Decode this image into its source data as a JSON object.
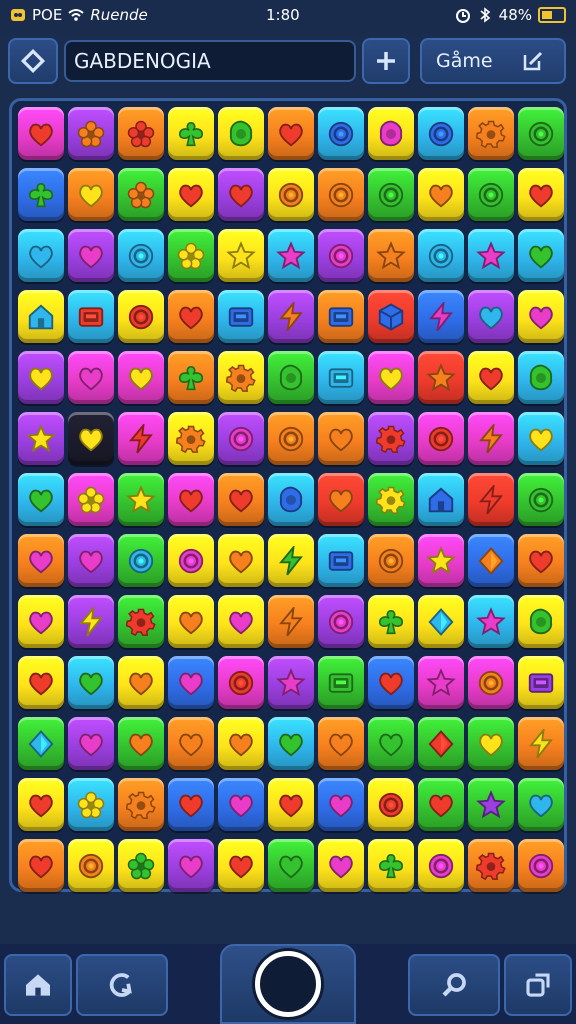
{
  "status_bar": {
    "left_text": "POE",
    "carrier": "Ruende",
    "time": "1:80",
    "battery_percent": "48%"
  },
  "toolbar": {
    "search_text": "GABDENOGIA",
    "game_label": "Gåme"
  },
  "colors": {
    "red": "#ef3b2c",
    "orange": "#f7801e",
    "yellow": "#ffe31a",
    "green": "#35c22f",
    "cyan": "#2fb6ec",
    "blue": "#2f6de8",
    "purple": "#9b3fe0",
    "magenta": "#e83cc9",
    "dark": "#1b1b2b"
  },
  "board": {
    "rows": 13,
    "cols": 11,
    "tiles": [
      [
        [
          "magenta",
          "heart",
          "red"
        ],
        [
          "purple",
          "flower",
          "orange"
        ],
        [
          "orange",
          "flower",
          "red"
        ],
        [
          "yellow",
          "clover",
          "green"
        ],
        [
          "yellow",
          "blob",
          "green"
        ],
        [
          "orange",
          "heart",
          "red"
        ],
        [
          "cyan",
          "ring",
          "blue"
        ],
        [
          "yellow",
          "blob",
          "magenta"
        ],
        [
          "cyan",
          "ring",
          "blue"
        ],
        [
          "orange",
          "gear",
          "orange"
        ],
        [
          "green",
          "ring",
          "green"
        ]
      ],
      [
        [
          "blue",
          "clover",
          "green"
        ],
        [
          "orange",
          "heart",
          "yellow"
        ],
        [
          "green",
          "flower",
          "orange"
        ],
        [
          "yellow",
          "heart",
          "red"
        ],
        [
          "purple",
          "heart",
          "red"
        ],
        [
          "yellow",
          "ring",
          "orange"
        ],
        [
          "orange",
          "ring",
          "orange"
        ],
        [
          "green",
          "ring",
          "green"
        ],
        [
          "yellow",
          "heart",
          "orange"
        ],
        [
          "green",
          "ring",
          "green"
        ],
        [
          "yellow",
          "heart",
          "red"
        ]
      ],
      [
        [
          "cyan",
          "heart",
          "cyan"
        ],
        [
          "purple",
          "heart",
          "magenta"
        ],
        [
          "cyan",
          "ring",
          "cyan"
        ],
        [
          "green",
          "flower",
          "yellow"
        ],
        [
          "yellow",
          "star",
          "yellow"
        ],
        [
          "cyan",
          "star",
          "magenta"
        ],
        [
          "purple",
          "ring",
          "magenta"
        ],
        [
          "orange",
          "star",
          "orange"
        ],
        [
          "cyan",
          "ring",
          "cyan"
        ],
        [
          "cyan",
          "star",
          "magenta"
        ],
        [
          "cyan",
          "heart",
          "green"
        ]
      ],
      [
        [
          "yellow",
          "house",
          "cyan"
        ],
        [
          "cyan",
          "box",
          "red"
        ],
        [
          "yellow",
          "ring",
          "red"
        ],
        [
          "orange",
          "heart",
          "red"
        ],
        [
          "cyan",
          "box",
          "blue"
        ],
        [
          "purple",
          "bolt",
          "orange"
        ],
        [
          "orange",
          "box",
          "blue"
        ],
        [
          "red",
          "cube",
          "blue"
        ],
        [
          "blue",
          "bolt",
          "magenta"
        ],
        [
          "purple",
          "heart",
          "cyan"
        ],
        [
          "yellow",
          "heart",
          "magenta"
        ]
      ],
      [
        [
          "purple",
          "heart",
          "yellow"
        ],
        [
          "magenta",
          "heart",
          "magenta"
        ],
        [
          "magenta",
          "heart",
          "yellow"
        ],
        [
          "orange",
          "clover",
          "green"
        ],
        [
          "yellow",
          "gear",
          "orange"
        ],
        [
          "green",
          "blob",
          "green"
        ],
        [
          "cyan",
          "box",
          "cyan"
        ],
        [
          "magenta",
          "heart",
          "yellow"
        ],
        [
          "red",
          "star",
          "orange"
        ],
        [
          "yellow",
          "heart",
          "red"
        ],
        [
          "cyan",
          "blob",
          "green"
        ]
      ],
      [
        [
          "purple",
          "star",
          "yellow"
        ],
        [
          "dark",
          "heart",
          "yellow"
        ],
        [
          "magenta",
          "bolt",
          "red"
        ],
        [
          "yellow",
          "gear",
          "orange"
        ],
        [
          "purple",
          "ring",
          "magenta"
        ],
        [
          "orange",
          "ring",
          "orange"
        ],
        [
          "orange",
          "heart",
          "orange"
        ],
        [
          "purple",
          "gear",
          "red"
        ],
        [
          "magenta",
          "ring",
          "red"
        ],
        [
          "magenta",
          "bolt",
          "orange"
        ],
        [
          "cyan",
          "heart",
          "yellow"
        ]
      ],
      [
        [
          "cyan",
          "heart",
          "green"
        ],
        [
          "magenta",
          "flower",
          "yellow"
        ],
        [
          "green",
          "star",
          "yellow"
        ],
        [
          "magenta",
          "heart",
          "red"
        ],
        [
          "orange",
          "heart",
          "red"
        ],
        [
          "cyan",
          "blob",
          "blue"
        ],
        [
          "red",
          "heart",
          "orange"
        ],
        [
          "green",
          "gear",
          "yellow"
        ],
        [
          "cyan",
          "house",
          "blue"
        ],
        [
          "red",
          "bolt",
          "red"
        ],
        [
          "green",
          "ring",
          "green"
        ]
      ],
      [
        [
          "orange",
          "heart",
          "magenta"
        ],
        [
          "purple",
          "heart",
          "magenta"
        ],
        [
          "green",
          "ring",
          "cyan"
        ],
        [
          "yellow",
          "ring",
          "magenta"
        ],
        [
          "yellow",
          "heart",
          "orange"
        ],
        [
          "yellow",
          "bolt",
          "green"
        ],
        [
          "cyan",
          "box",
          "blue"
        ],
        [
          "orange",
          "ring",
          "orange"
        ],
        [
          "magenta",
          "star",
          "yellow"
        ],
        [
          "blue",
          "diamond",
          "orange"
        ],
        [
          "orange",
          "heart",
          "red"
        ]
      ],
      [
        [
          "yellow",
          "heart",
          "magenta"
        ],
        [
          "purple",
          "bolt",
          "yellow"
        ],
        [
          "green",
          "gear",
          "red"
        ],
        [
          "yellow",
          "heart",
          "orange"
        ],
        [
          "yellow",
          "heart",
          "magenta"
        ],
        [
          "orange",
          "bolt",
          "orange"
        ],
        [
          "purple",
          "ring",
          "magenta"
        ],
        [
          "yellow",
          "clover",
          "green"
        ],
        [
          "yellow",
          "diamond",
          "cyan"
        ],
        [
          "cyan",
          "star",
          "magenta"
        ],
        [
          "yellow",
          "blob",
          "green"
        ]
      ],
      [
        [
          "yellow",
          "heart",
          "red"
        ],
        [
          "cyan",
          "heart",
          "green"
        ],
        [
          "yellow",
          "heart",
          "orange"
        ],
        [
          "blue",
          "heart",
          "magenta"
        ],
        [
          "magenta",
          "ring",
          "red"
        ],
        [
          "purple",
          "star",
          "magenta"
        ],
        [
          "green",
          "box",
          "green"
        ],
        [
          "blue",
          "heart",
          "red"
        ],
        [
          "magenta",
          "star",
          "magenta"
        ],
        [
          "magenta",
          "ring",
          "orange"
        ],
        [
          "yellow",
          "box",
          "purple"
        ]
      ],
      [
        [
          "green",
          "diamond",
          "cyan"
        ],
        [
          "purple",
          "heart",
          "magenta"
        ],
        [
          "green",
          "heart",
          "orange"
        ],
        [
          "orange",
          "heart",
          "orange"
        ],
        [
          "yellow",
          "heart",
          "orange"
        ],
        [
          "cyan",
          "heart",
          "green"
        ],
        [
          "orange",
          "heart",
          "orange"
        ],
        [
          "green",
          "heart",
          "green"
        ],
        [
          "green",
          "diamond",
          "red"
        ],
        [
          "green",
          "heart",
          "yellow"
        ],
        [
          "orange",
          "bolt",
          "yellow"
        ]
      ],
      [
        [
          "yellow",
          "heart",
          "red"
        ],
        [
          "cyan",
          "flower",
          "yellow"
        ],
        [
          "orange",
          "gear",
          "orange"
        ],
        [
          "blue",
          "heart",
          "red"
        ],
        [
          "blue",
          "heart",
          "magenta"
        ],
        [
          "yellow",
          "heart",
          "red"
        ],
        [
          "blue",
          "heart",
          "magenta"
        ],
        [
          "yellow",
          "ring",
          "red"
        ],
        [
          "green",
          "heart",
          "red"
        ],
        [
          "green",
          "star",
          "purple"
        ],
        [
          "green",
          "heart",
          "cyan"
        ]
      ],
      [
        [
          "orange",
          "heart",
          "red"
        ],
        [
          "yellow",
          "ring",
          "orange"
        ],
        [
          "yellow",
          "flower",
          "green"
        ],
        [
          "purple",
          "heart",
          "magenta"
        ],
        [
          "yellow",
          "heart",
          "red"
        ],
        [
          "green",
          "heart",
          "green"
        ],
        [
          "yellow",
          "heart",
          "magenta"
        ],
        [
          "yellow",
          "clover",
          "green"
        ],
        [
          "yellow",
          "ring",
          "magenta"
        ],
        [
          "orange",
          "gear",
          "red"
        ],
        [
          "orange",
          "ring",
          "magenta"
        ]
      ]
    ]
  }
}
